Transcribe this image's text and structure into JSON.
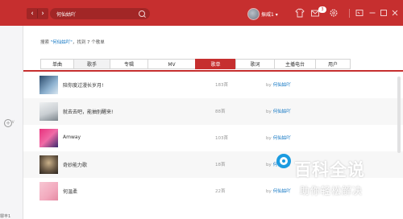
{
  "header": {
    "search_value": "何仙姑吖",
    "user_name": "振威1",
    "user_dropdown_glyph": "▾",
    "back_glyph": "‹",
    "forward_glyph": "›",
    "message_badge": "3",
    "brand_color": "#c62f2f"
  },
  "summary": {
    "prefix": "搜索 ",
    "keyword": "\"何仙姑吖\"",
    "suffix": "，找到 7 个歌单"
  },
  "tabs": [
    {
      "label": "单曲",
      "state": "normal"
    },
    {
      "label": "歌手",
      "state": "hover"
    },
    {
      "label": "专辑",
      "state": "normal"
    },
    {
      "label": "MV",
      "state": "normal"
    },
    {
      "label": "歌单",
      "state": "active"
    },
    {
      "label": "歌词",
      "state": "normal"
    },
    {
      "label": "主播电台",
      "state": "normal"
    },
    {
      "label": "用户",
      "state": "normal"
    }
  ],
  "playlists": [
    {
      "name": "陪你度过漫长岁月!",
      "count": "183首",
      "by": "by",
      "creator": "何仙姑吖"
    },
    {
      "name": "就去去吧，能抽别醒来!",
      "count": "88首",
      "by": "by",
      "creator": "何仙姑吖"
    },
    {
      "name": "Amway",
      "count": "103首",
      "by": "by",
      "creator": "何仙姑吖"
    },
    {
      "name": "奇妙能力歌",
      "count": "18首",
      "by": "by",
      "creator": "何仙姑吖"
    },
    {
      "name": "何温柔",
      "count": "22首",
      "by": "by",
      "creator": "何仙姑吖"
    }
  ],
  "sidebar": {
    "bottom_text": "罪丰1"
  },
  "watermark": {
    "title": "百科全说",
    "subtitle": "助你轻松解决"
  }
}
